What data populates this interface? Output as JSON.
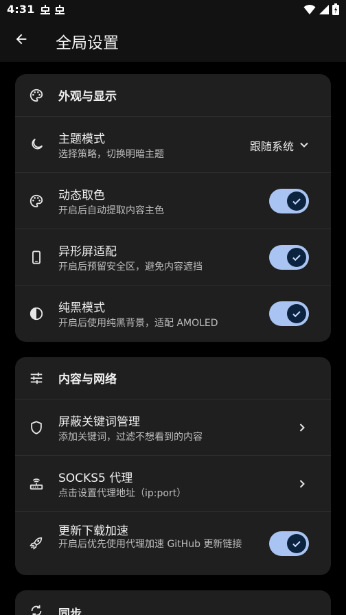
{
  "status_bar": {
    "time": "4:31",
    "notification_icons": [
      "bug-icon",
      "bug-icon"
    ],
    "right_icons": [
      "wifi-icon",
      "signal-icon",
      "battery-icon"
    ]
  },
  "app_bar": {
    "title": "全局设置"
  },
  "colors": {
    "toggle_track": "#a9c4f2",
    "toggle_knob": "#0c2340",
    "card_bg": "#1f1f1f"
  },
  "sections": [
    {
      "title": "外观与显示",
      "icon": "palette-icon",
      "rows": [
        {
          "title": "主题模式",
          "subtitle": "选择策略，切换明暗主题",
          "icon": "moon-icon",
          "control": "dropdown",
          "value": "跟随系统"
        },
        {
          "title": "动态取色",
          "subtitle": "开启后自动提取内容主色",
          "icon": "palette-icon",
          "control": "toggle",
          "checked": true
        },
        {
          "title": "异形屏适配",
          "subtitle": "开启后预留安全区，避免内容遮挡",
          "icon": "phone-icon",
          "control": "toggle",
          "checked": true
        },
        {
          "title": "纯黑模式",
          "subtitle": "开启后使用纯黑背景，适配 AMOLED",
          "icon": "contrast-icon",
          "control": "toggle",
          "checked": true
        }
      ]
    },
    {
      "title": "内容与网络",
      "icon": "tune-icon",
      "rows": [
        {
          "title": "屏蔽关键词管理",
          "subtitle": "添加关键词，过滤不想看到的内容",
          "icon": "shield-icon",
          "control": "chevron"
        },
        {
          "title": "SOCKS5 代理",
          "subtitle": "点击设置代理地址（ip:port）",
          "icon": "router-icon",
          "control": "chevron"
        },
        {
          "title": "更新下载加速",
          "subtitle": "开启后优先使用代理加速 GitHub 更新链接",
          "icon": "rocket-icon",
          "control": "toggle",
          "checked": true
        }
      ]
    },
    {
      "title": "同步",
      "icon": "sync-icon",
      "rows": []
    }
  ]
}
